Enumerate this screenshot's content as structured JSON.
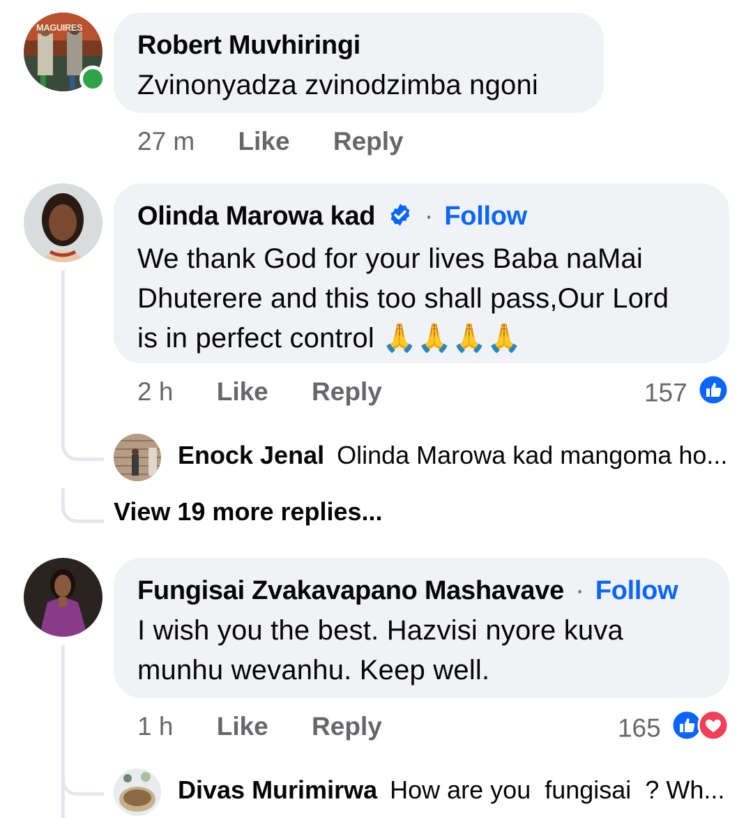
{
  "comments": [
    {
      "author": "Robert Muvhiringi",
      "avatar_text": "MAGUIRES",
      "text": "Zvinonyadza zvinodzimba ngoni",
      "time": "27 m",
      "like_label": "Like",
      "reply_label": "Reply",
      "online": true
    },
    {
      "author": "Olinda Marowa kad",
      "verified": true,
      "follow_label": "Follow",
      "separator": "·",
      "text": "We thank God for your lives Baba naMai Dhuterere and this too shall pass,Our Lord is in perfect control 🙏🙏🙏🙏",
      "time": "2 h",
      "like_label": "Like",
      "reply_label": "Reply",
      "reaction_count": "157",
      "reactions": [
        "like-icon"
      ],
      "reply_preview": {
        "author": "Enock Jenal",
        "text": "Olinda Marowa kad mangoma ho..."
      },
      "view_more": "View 19 more replies..."
    },
    {
      "author": "Fungisai Zvakavapano Mashavave",
      "follow_label": "Follow",
      "separator": "·",
      "text": "I wish you the best. Hazvisi nyore kuva munhu wevanhu. Keep well.",
      "time": "1 h",
      "like_label": "Like",
      "reply_label": "Reply",
      "reaction_count": "165",
      "reactions": [
        "like-icon",
        "love-icon"
      ],
      "reply_preview": {
        "author": "Divas Murimirwa",
        "text": "How are you  fungisai  ? Wh..."
      }
    }
  ],
  "colors": {
    "bubble": "#f0f2f5",
    "link": "#0866ff",
    "meta": "#65676b",
    "online": "#31a24c",
    "like": "#0866ff",
    "love": "#f33e58"
  }
}
